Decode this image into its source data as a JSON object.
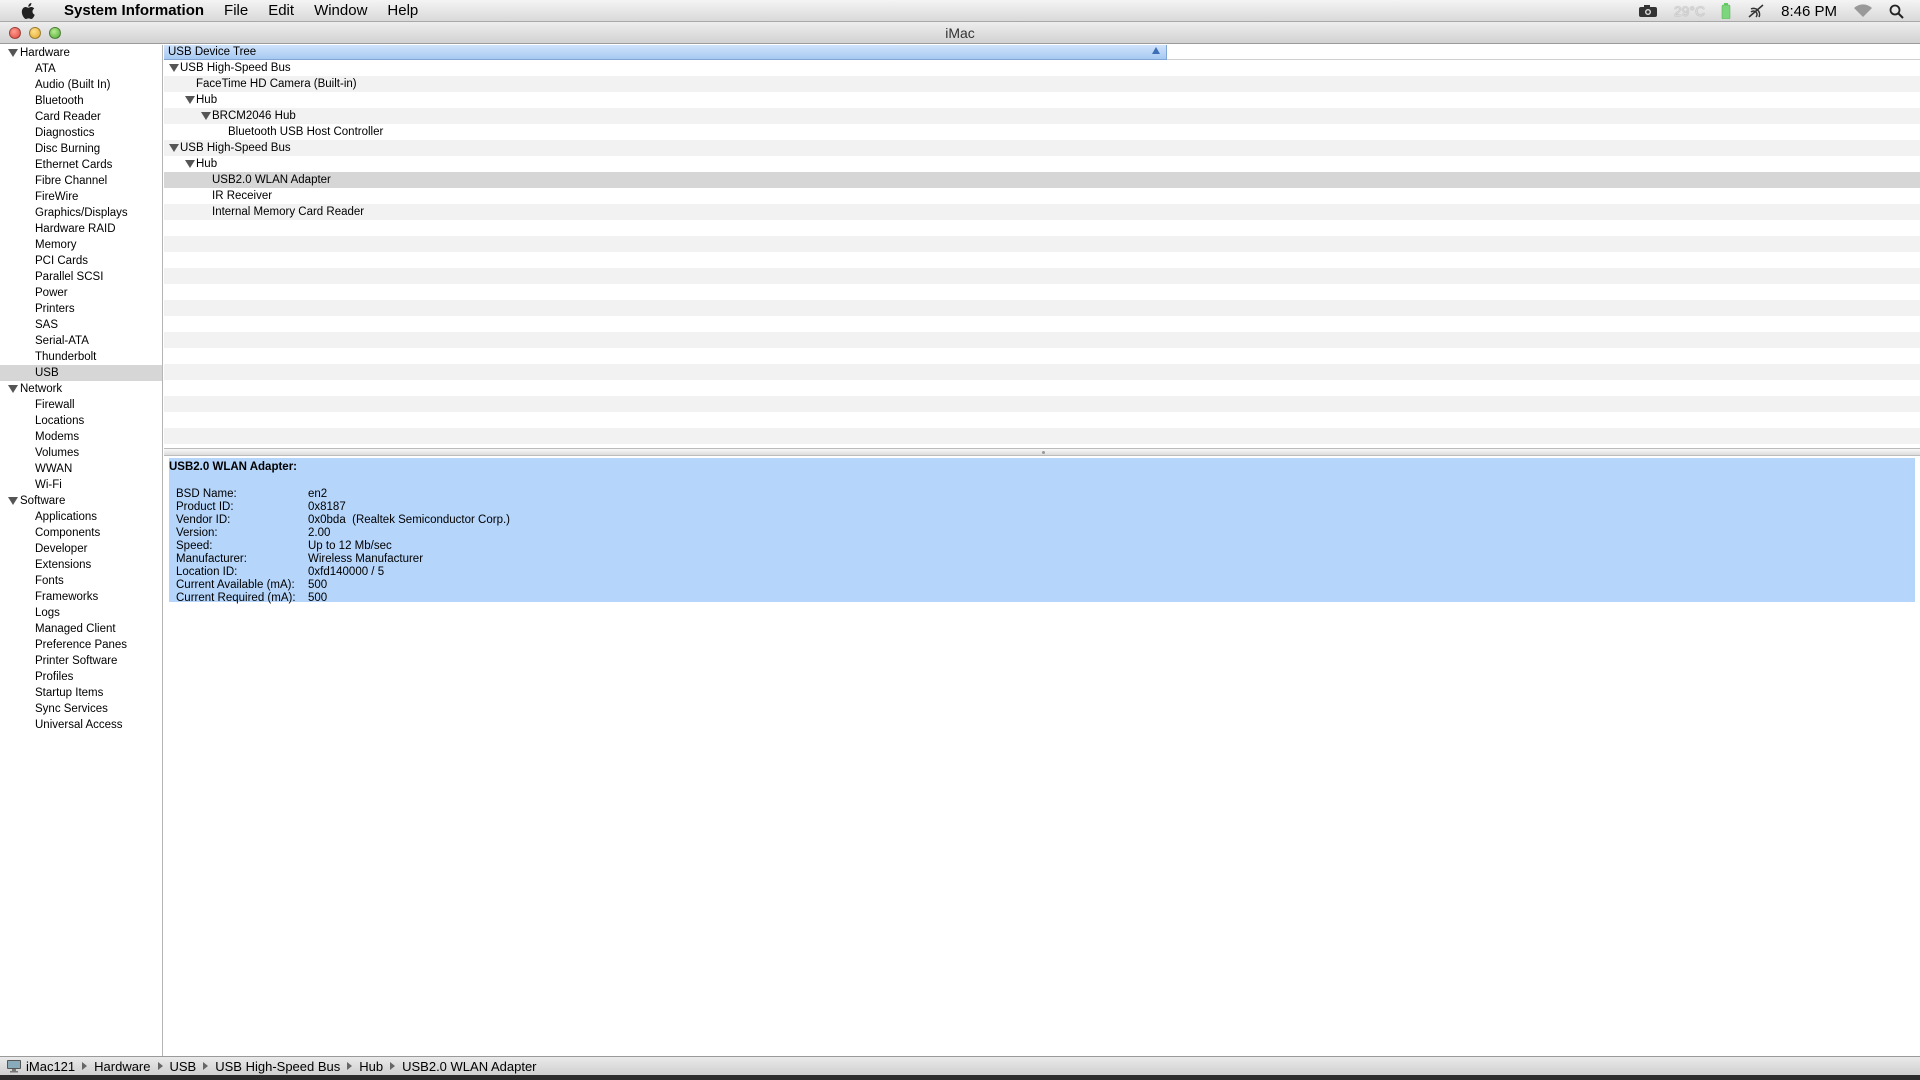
{
  "menubar": {
    "app_name": "System Information",
    "items": [
      "File",
      "Edit",
      "Window",
      "Help"
    ],
    "status": {
      "temperature": "29°C",
      "time": "8:46 PM"
    }
  },
  "window": {
    "title": "iMac"
  },
  "sidebar": {
    "groups": [
      {
        "label": "Hardware",
        "items": [
          "ATA",
          "Audio (Built In)",
          "Bluetooth",
          "Card Reader",
          "Diagnostics",
          "Disc Burning",
          "Ethernet Cards",
          "Fibre Channel",
          "FireWire",
          "Graphics/Displays",
          "Hardware RAID",
          "Memory",
          "PCI Cards",
          "Parallel SCSI",
          "Power",
          "Printers",
          "SAS",
          "Serial-ATA",
          "Thunderbolt",
          "USB"
        ]
      },
      {
        "label": "Network",
        "items": [
          "Firewall",
          "Locations",
          "Modems",
          "Volumes",
          "WWAN",
          "Wi-Fi"
        ]
      },
      {
        "label": "Software",
        "items": [
          "Applications",
          "Components",
          "Developer",
          "Extensions",
          "Fonts",
          "Frameworks",
          "Logs",
          "Managed Client",
          "Preference Panes",
          "Printer Software",
          "Profiles",
          "Startup Items",
          "Sync Services",
          "Universal Access"
        ]
      }
    ],
    "selected": "USB"
  },
  "tree": {
    "header": "USB Device Tree",
    "rows": [
      {
        "label": "USB High-Speed Bus",
        "level": 0,
        "expandable": true
      },
      {
        "label": "FaceTime HD Camera (Built-in)",
        "level": 1,
        "expandable": false
      },
      {
        "label": "Hub",
        "level": 1,
        "expandable": true
      },
      {
        "label": "BRCM2046 Hub",
        "level": 2,
        "expandable": true
      },
      {
        "label": "Bluetooth USB Host Controller",
        "level": 3,
        "expandable": false
      },
      {
        "label": "USB High-Speed Bus",
        "level": 0,
        "expandable": true
      },
      {
        "label": "Hub",
        "level": 1,
        "expandable": true
      },
      {
        "label": "USB2.0 WLAN Adapter",
        "level": 2,
        "expandable": false,
        "selected": true
      },
      {
        "label": "IR Receiver",
        "level": 2,
        "expandable": false
      },
      {
        "label": "Internal Memory Card Reader",
        "level": 2,
        "expandable": false
      }
    ]
  },
  "detail": {
    "title": "USB2.0 WLAN Adapter:",
    "fields": [
      {
        "label": "BSD Name:",
        "value": "en2"
      },
      {
        "label": "Product ID:",
        "value": "0x8187"
      },
      {
        "label": "Vendor ID:",
        "value": "0x0bda  (Realtek Semiconductor Corp.)"
      },
      {
        "label": "Version:",
        "value": "2.00"
      },
      {
        "label": "Speed:",
        "value": "Up to 12 Mb/sec"
      },
      {
        "label": "Manufacturer:",
        "value": "Wireless Manufacturer"
      },
      {
        "label": "Location ID:",
        "value": "0xfd140000 / 5"
      },
      {
        "label": "Current Available (mA):",
        "value": "500"
      },
      {
        "label": "Current Required (mA):",
        "value": "500"
      }
    ]
  },
  "statusbar": {
    "crumbs": [
      "iMac121",
      "Hardware",
      "USB",
      "USB High-Speed Bus",
      "Hub",
      "USB2.0 WLAN Adapter"
    ]
  }
}
